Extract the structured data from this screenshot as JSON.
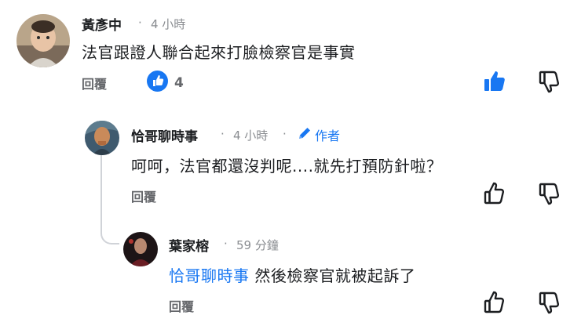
{
  "comments": [
    {
      "author": "黃彥中",
      "sep": "·",
      "time": "4 小時",
      "text": "法官跟證人聯合起來打臉檢察官是事實",
      "reply_label": "回覆",
      "reaction_count": "4"
    },
    {
      "author": "恰哥聊時事",
      "sep": "·",
      "time": "4 小時",
      "sep2": "·",
      "author_badge": "作者",
      "text": "呵呵，法官都還沒判呢....就先打預防針啦？",
      "reply_label": "回覆"
    },
    {
      "author": "葉家榕",
      "sep": "·",
      "time": "59 分鐘",
      "mention": "恰哥聊時事",
      "text": " 然後檢察官就被起訴了",
      "reply_label": "回覆"
    }
  ],
  "colors": {
    "like_blue": "#1877f2",
    "text": "#1c1e21",
    "meta": "#8a8d91"
  },
  "icons": [
    "thumb-up-filled-icon",
    "thumb-down-icon",
    "thumb-up-outline-icon",
    "pencil-icon"
  ]
}
